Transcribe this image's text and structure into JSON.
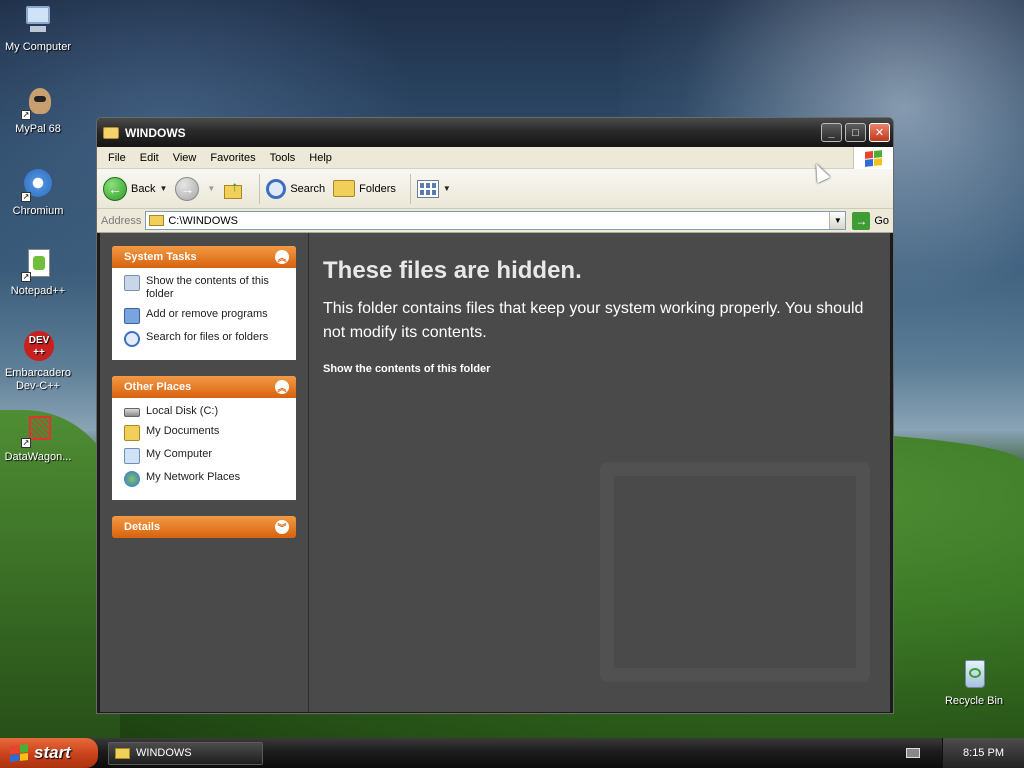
{
  "desktop": {
    "icons": [
      {
        "label": "My Computer"
      },
      {
        "label": "MyPal 68"
      },
      {
        "label": "Chromium"
      },
      {
        "label": "Notepad++"
      },
      {
        "label": "Embarcadero Dev-C++"
      },
      {
        "label": "DataWagon..."
      },
      {
        "label": "Recycle Bin"
      }
    ]
  },
  "window": {
    "title": "WINDOWS",
    "controls": {
      "minimize": "_",
      "maximize": "□",
      "close": "✕"
    }
  },
  "menubar": {
    "items": [
      "File",
      "Edit",
      "View",
      "Favorites",
      "Tools",
      "Help"
    ]
  },
  "toolbar": {
    "back_label": "Back",
    "search_label": "Search",
    "folders_label": "Folders"
  },
  "address": {
    "label": "Address",
    "value": "C:\\WINDOWS",
    "go_label": "Go"
  },
  "taskpane": {
    "system_tasks": {
      "title": "System Tasks",
      "items": [
        "Show the contents of this folder",
        "Add or remove programs",
        "Search for files or folders"
      ]
    },
    "other_places": {
      "title": "Other Places",
      "items": [
        "Local Disk (C:)",
        "My Documents",
        "My Computer",
        "My Network Places"
      ]
    },
    "details": {
      "title": "Details"
    }
  },
  "main": {
    "title": "These files are hidden.",
    "description": "This folder contains files that keep your system working properly. You should not modify its contents.",
    "link": "Show the contents of this folder"
  },
  "taskbar": {
    "start_label": "start",
    "task_title": "WINDOWS",
    "clock": "8:15 PM"
  },
  "colors": {
    "taskpane_header": "#d8620e",
    "main_bg": "#4a4a4a",
    "start_button": "#c9421b"
  }
}
